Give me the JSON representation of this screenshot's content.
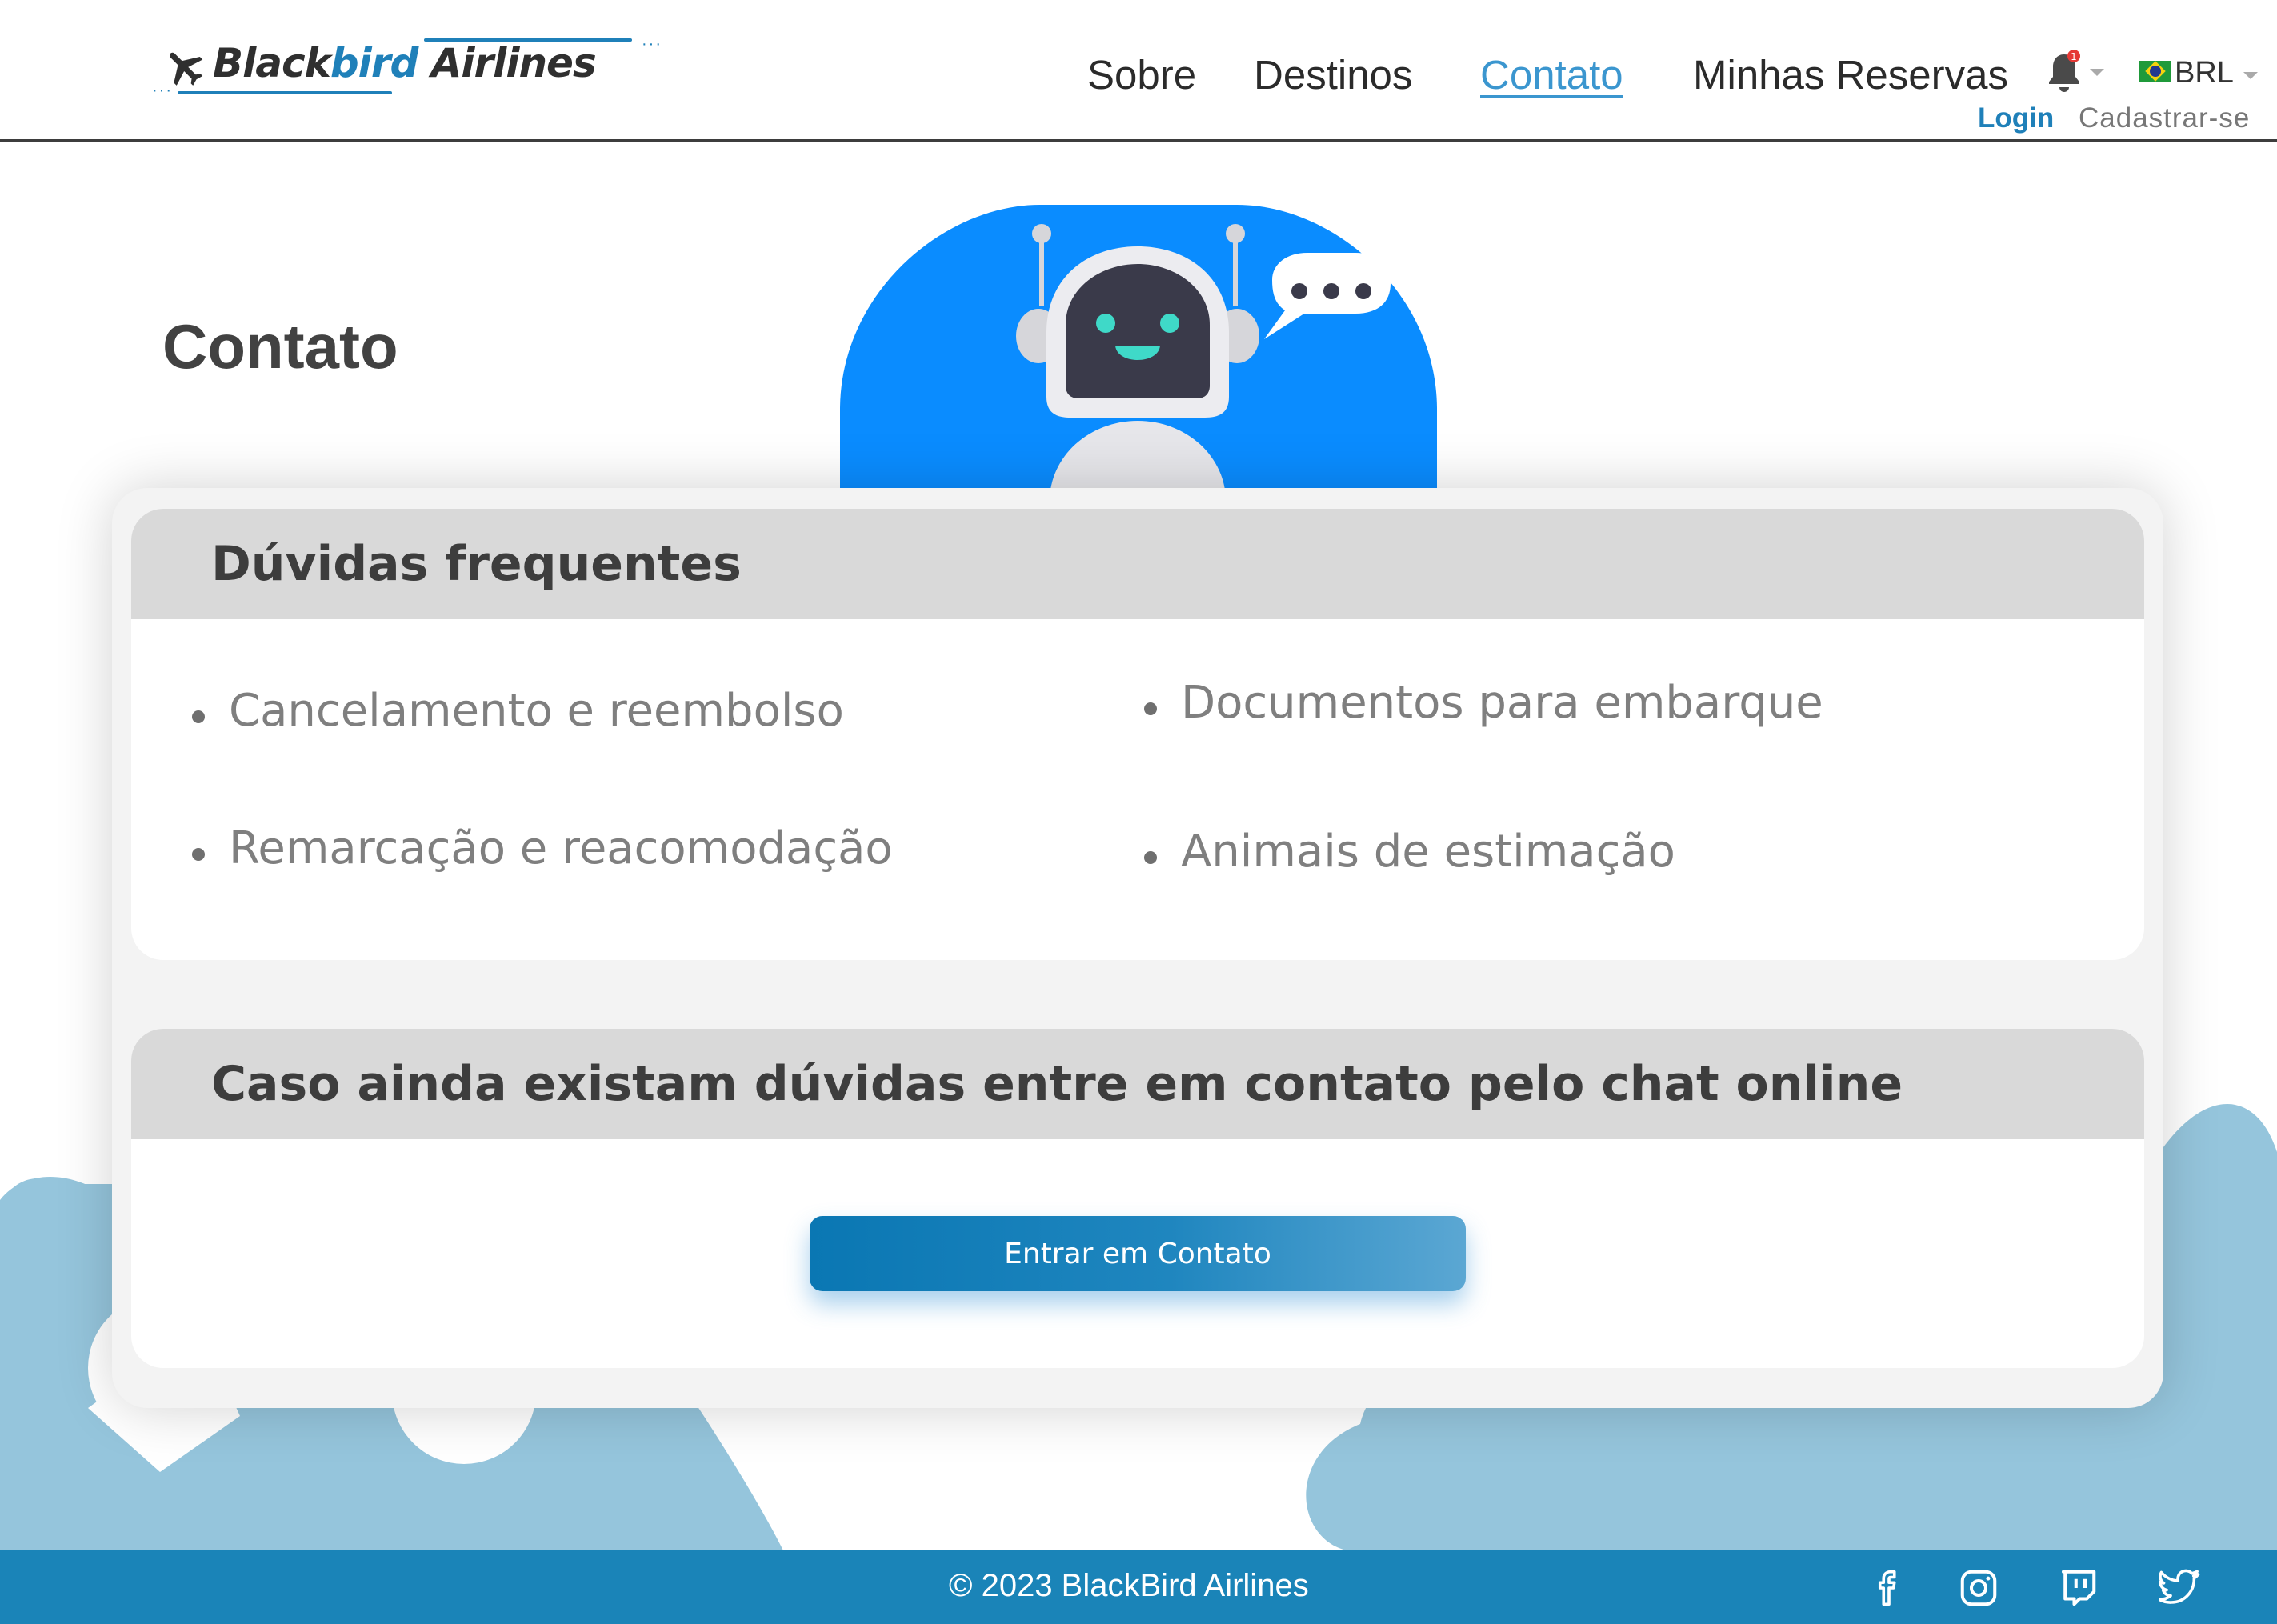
{
  "brand": {
    "name_part1": "Black",
    "name_part2": "bird",
    "name_part3": " Airlines",
    "accent_color": "#1f80b9"
  },
  "nav": {
    "items": [
      {
        "label": "Sobre",
        "active": false
      },
      {
        "label": "Destinos",
        "active": false
      },
      {
        "label": "Contato",
        "active": true
      },
      {
        "label": "Minhas Reservas",
        "active": false
      }
    ],
    "notification_icon": "bell-icon",
    "notification_badge": "1",
    "currency": "BRL",
    "currency_flag": "brazil-flag-icon",
    "login_label": "Login",
    "signup_label": "Cadastrar-se"
  },
  "hero": {
    "title": "Contato",
    "illustration": "chatbot-robot-illustration"
  },
  "faq": {
    "title": "Dúvidas frequentes",
    "items": [
      "Cancelamento e reembolso",
      "Documentos para embarque",
      "Remarcação e reacomodação",
      "Animais de estimação"
    ]
  },
  "contact": {
    "title": "Caso ainda existam dúvidas entre em contato pelo chat online",
    "button_label": "Entrar em Contato"
  },
  "footer": {
    "copyright": "© 2023 BlackBird Airlines",
    "social": [
      "facebook-icon",
      "instagram-icon",
      "twitch-icon",
      "twitter-icon"
    ],
    "color": "#1a84b8"
  },
  "colors": {
    "primary_blue": "#1a84b8",
    "robot_bg": "#0a8cff",
    "cloud": "#95c5dc"
  }
}
